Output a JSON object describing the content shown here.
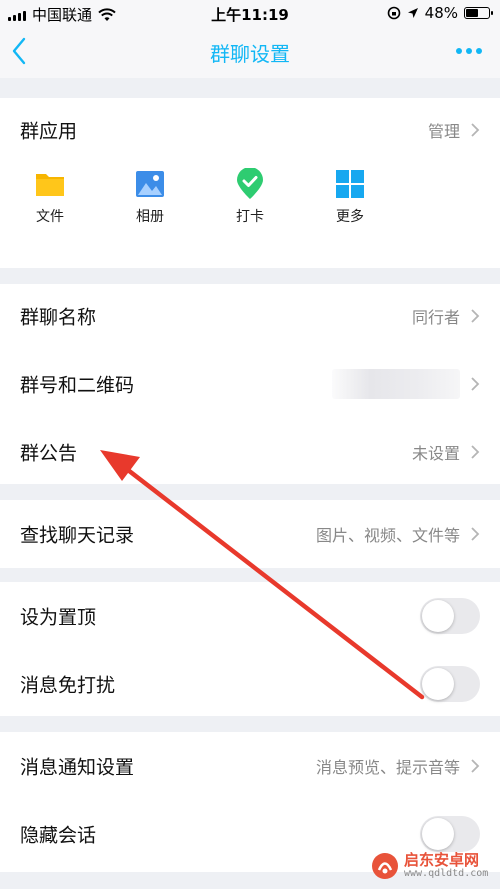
{
  "status_bar": {
    "carrier": "中国联通",
    "time": "上午11:19",
    "battery": "48%"
  },
  "nav": {
    "title": "群聊设置",
    "back_icon": "chevron-left-icon",
    "more_icon": "more-dots-icon"
  },
  "group_apps": {
    "title": "群应用",
    "manage_label": "管理",
    "items": [
      {
        "label": "文件",
        "icon": "folder-icon",
        "color": "#f7b500"
      },
      {
        "label": "相册",
        "icon": "album-icon",
        "color": "#3c8de8"
      },
      {
        "label": "打卡",
        "icon": "checkin-icon",
        "color": "#2ecc71"
      },
      {
        "label": "更多",
        "icon": "grid-icon",
        "color": "#17a8f0"
      }
    ]
  },
  "group_info": {
    "name_label": "群聊名称",
    "name_value": "同行者",
    "qr_label": "群号和二维码",
    "notice_label": "群公告",
    "notice_value": "未设置"
  },
  "history": {
    "label": "查找聊天记录",
    "value": "图片、视频、文件等"
  },
  "toggles": {
    "pin_label": "设为置顶",
    "pin_on": false,
    "mute_label": "消息免打扰",
    "mute_on": false
  },
  "notify": {
    "label": "消息通知设置",
    "value": "消息预览、提示音等",
    "hide_label": "隐藏会话",
    "hide_on": false
  },
  "watermark": {
    "name": "启东安卓网",
    "url": "www.qdldtd.com"
  },
  "colors": {
    "accent": "#12b7f5",
    "annotation": "#e8392c"
  }
}
